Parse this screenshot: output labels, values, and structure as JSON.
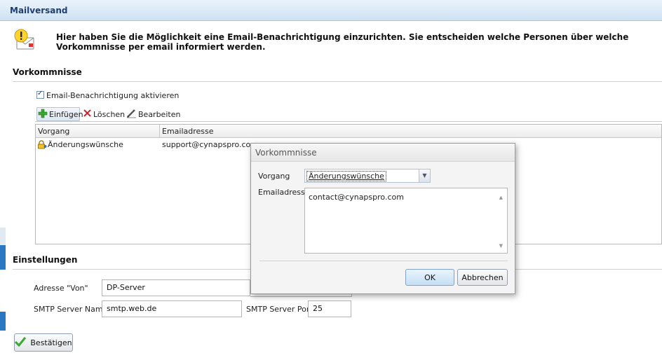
{
  "header": {
    "title": "Mailversand"
  },
  "info": {
    "icon": "warning-mail-icon",
    "text": "Hier haben Sie die Möglichkeit eine Email-Benachrichtigung einzurichten. Sie entscheiden welche Personen über welche Vorkommnisse per email informiert werden."
  },
  "vorkommnisse": {
    "title": "Vorkommnisse",
    "checkbox_label": "Email-Benachrichtigung aktivieren",
    "checkbox_checked": true,
    "toolbar": {
      "add": "Einfügen",
      "delete": "Löschen",
      "edit": "Bearbeiten"
    },
    "columns": [
      "Vorgang",
      "Emailadresse"
    ],
    "rows": [
      {
        "vorgang": "Änderungswünsche",
        "email": "support@cynapspro.com"
      }
    ]
  },
  "einstellungen": {
    "title": "Einstellungen",
    "von_label": "Adresse \"Von\"",
    "von_value": "DP-Server",
    "smtp_name_label": "SMTP Server Name",
    "smtp_name_value": "smtp.web.de",
    "smtp_port_label": "SMTP Server Port",
    "smtp_port_value": "25"
  },
  "confirm_label": "Bestätigen",
  "dialog": {
    "title": "Vorkommnisse",
    "vorgang_label": "Vorgang",
    "vorgang_value": "Änderungswünsche",
    "email_label": "Emailadresse",
    "email_value": "contact@cynapspro.com",
    "ok_label": "OK",
    "cancel_label": "Abbrechen"
  },
  "colors": {
    "header_text": "#1f3f6e",
    "accent_blue": "#2b78c2",
    "add_green": "#3aa832",
    "delete_red": "#c0282d"
  }
}
